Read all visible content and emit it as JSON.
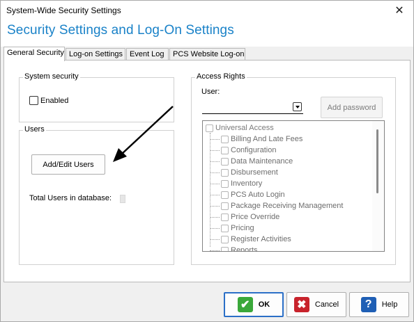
{
  "window": {
    "title": "System-Wide Security Settings",
    "close_glyph": "✕"
  },
  "header": {
    "heading": "Security Settings and Log-On Settings"
  },
  "tabs": [
    {
      "label": "General Security",
      "active": true
    },
    {
      "label": "Log-on Settings",
      "active": false
    },
    {
      "label": "Event Log",
      "active": false
    },
    {
      "label": "PCS Website Log-on",
      "active": false
    }
  ],
  "system_security": {
    "legend": "System security",
    "enabled_label": "Enabled",
    "enabled_checked": false
  },
  "users": {
    "legend": "Users",
    "add_edit_button": "Add/Edit Users",
    "total_label": "Total Users in database:",
    "total_value": ""
  },
  "access_rights": {
    "legend": "Access Rights",
    "user_label": "User:",
    "user_value": "",
    "add_password_button": "Add password",
    "tree_root": "Universal Access",
    "tree_items": [
      "Billing And Late Fees",
      "Configuration",
      "Data Maintenance",
      "Disbursement",
      "Inventory",
      "PCS Auto Login",
      "Package Receiving Management",
      "Price Override",
      "Pricing",
      "Register Activities",
      "Reports"
    ]
  },
  "footer": {
    "ok_label": "OK",
    "cancel_label": "Cancel",
    "help_label": "Help",
    "ok_icon": "checkmark-icon",
    "cancel_icon": "x-icon",
    "help_icon": "question-icon",
    "ok_color": "#3aa83a",
    "cancel_color": "#c8232c",
    "help_color": "#1f5fb5"
  }
}
